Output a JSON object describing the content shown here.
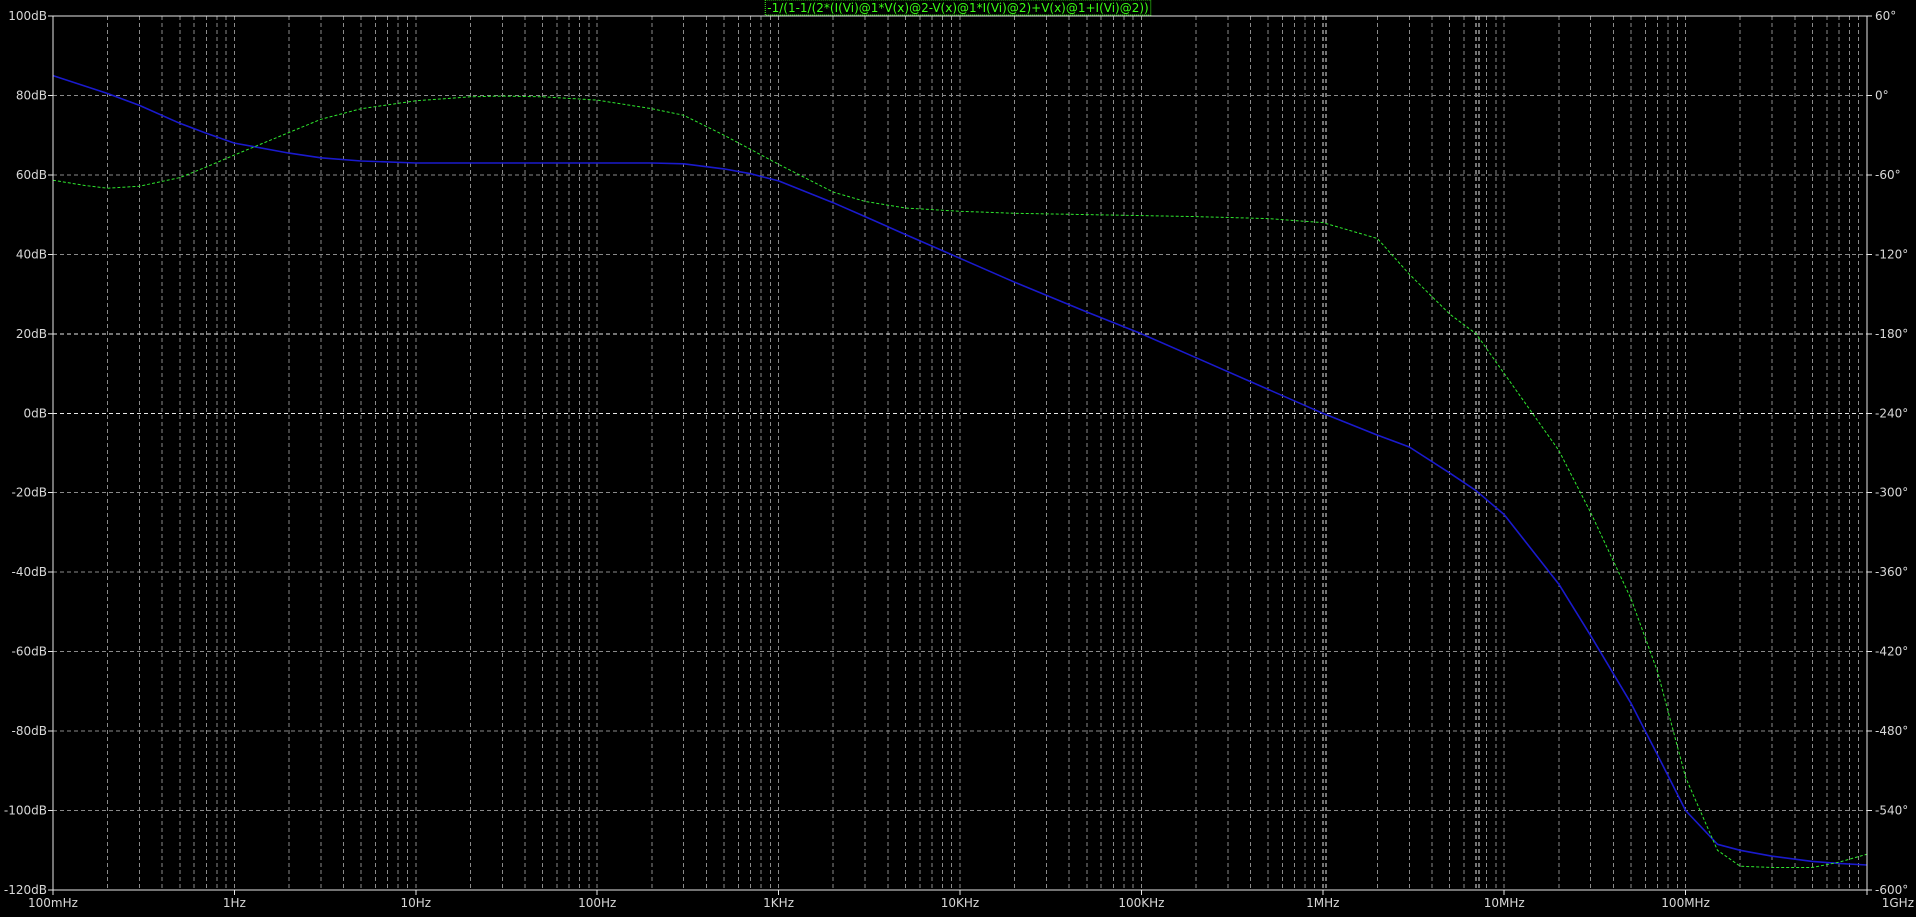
{
  "plot": {
    "background": "#000000",
    "grid_color": "#8a8a8a",
    "label_color": "#d8d8d8",
    "highlight_grid_color": "#e8e8e8"
  },
  "chart_data": {
    "type": "line",
    "title": "-1/(1-1/(2*(I(Vi)@1*V(x)@2-V(x)@1*I(Vi)@2)+V(x)@1+I(Vi)@2))",
    "x_scale": "log",
    "xlim": [
      0.1,
      1000000000
    ],
    "ylim": [
      -120,
      100
    ],
    "y2lim": [
      -600,
      60
    ],
    "grid": true,
    "x_ticks": [
      {
        "value": 0.1,
        "label": "100mHz"
      },
      {
        "value": 1,
        "label": "1Hz"
      },
      {
        "value": 10,
        "label": "10Hz"
      },
      {
        "value": 100,
        "label": "100Hz"
      },
      {
        "value": 1000,
        "label": "1KHz"
      },
      {
        "value": 10000,
        "label": "10KHz"
      },
      {
        "value": 100000,
        "label": "100KHz"
      },
      {
        "value": 1000000,
        "label": "1MHz"
      },
      {
        "value": 10000000,
        "label": "10MHz"
      },
      {
        "value": 100000000,
        "label": "100MHz"
      },
      {
        "value": 1000000000,
        "label": "1GHz"
      }
    ],
    "y_ticks": [
      {
        "value": 100,
        "label": "100dB"
      },
      {
        "value": 80,
        "label": "80dB"
      },
      {
        "value": 60,
        "label": "60dB"
      },
      {
        "value": 40,
        "label": "40dB"
      },
      {
        "value": 20,
        "label": "20dB"
      },
      {
        "value": 0,
        "label": "0dB"
      },
      {
        "value": -20,
        "label": "-20dB"
      },
      {
        "value": -40,
        "label": "-40dB"
      },
      {
        "value": -60,
        "label": "-60dB"
      },
      {
        "value": -80,
        "label": "-80dB"
      },
      {
        "value": -100,
        "label": "-100dB"
      },
      {
        "value": -120,
        "label": "-120dB"
      }
    ],
    "y2_ticks": [
      {
        "value": 60,
        "label": "60°"
      },
      {
        "value": 0,
        "label": "0°"
      },
      {
        "value": -60,
        "label": "-60°"
      },
      {
        "value": -120,
        "label": "-120°"
      },
      {
        "value": -180,
        "label": "-180°"
      },
      {
        "value": -240,
        "label": "-240°"
      },
      {
        "value": -300,
        "label": "-300°"
      },
      {
        "value": -360,
        "label": "-360°"
      },
      {
        "value": -420,
        "label": "-420°"
      },
      {
        "value": -480,
        "label": "-480°"
      },
      {
        "value": -540,
        "label": "-540°"
      },
      {
        "value": -600,
        "label": "-600°"
      }
    ],
    "highlight_x": [
      1000000,
      7000000
    ],
    "highlight_y": [
      20,
      0
    ],
    "series": [
      {
        "axis": "left",
        "color": "#1a1acd",
        "dashed": false,
        "x": [
          0.1,
          0.2,
          0.3,
          0.5,
          0.7,
          1,
          2,
          3,
          5,
          10,
          20,
          50,
          100,
          200,
          300,
          500,
          700,
          1000,
          2000,
          3000,
          5000,
          10000,
          20000,
          50000,
          100000,
          200000,
          500000,
          1000000,
          2000000,
          3000000,
          5000000,
          7000000,
          10000000,
          20000000,
          30000000,
          50000000,
          70000000,
          100000000,
          150000000,
          200000000,
          300000000,
          500000000,
          700000000,
          1000000000
        ],
        "y": [
          85,
          80.5,
          77.5,
          73,
          70.5,
          68,
          65.5,
          64.3,
          63.5,
          63,
          63,
          63,
          63,
          63,
          62.8,
          61.5,
          60.3,
          58.5,
          53,
          49.5,
          45,
          39,
          33,
          25.5,
          20,
          14,
          6,
          0,
          -5.5,
          -8.5,
          -15,
          -19.5,
          -25.5,
          -43,
          -56,
          -73,
          -86,
          -100,
          -108.5,
          -110,
          -111.5,
          -112.8,
          -113.3,
          -113.7
        ]
      },
      {
        "axis": "right",
        "color": "#2ee62e",
        "dashed": true,
        "x": [
          0.1,
          0.15,
          0.2,
          0.3,
          0.5,
          0.7,
          1,
          2,
          3,
          5,
          10,
          20,
          30,
          50,
          100,
          200,
          300,
          500,
          1000,
          2000,
          3000,
          5000,
          10000,
          20000,
          50000,
          100000,
          200000,
          500000,
          1000000,
          2000000,
          3000000,
          5000000,
          7000000,
          10000000,
          20000000,
          30000000,
          50000000,
          70000000,
          100000000,
          150000000,
          200000000,
          300000000,
          500000000,
          700000000,
          1000000000
        ],
        "y": [
          -64,
          -68,
          -70,
          -68.5,
          -62,
          -54,
          -45,
          -28,
          -18,
          -10,
          -4,
          -1,
          -0.5,
          -1,
          -3.5,
          -10,
          -15,
          -30,
          -52,
          -73,
          -80,
          -85,
          -87.5,
          -89,
          -90,
          -90.7,
          -91.5,
          -93,
          -96,
          -108,
          -135,
          -165,
          -180,
          -210,
          -268,
          -315,
          -380,
          -435,
          -515,
          -570,
          -582,
          -583,
          -583,
          -579,
          -573
        ]
      }
    ]
  }
}
